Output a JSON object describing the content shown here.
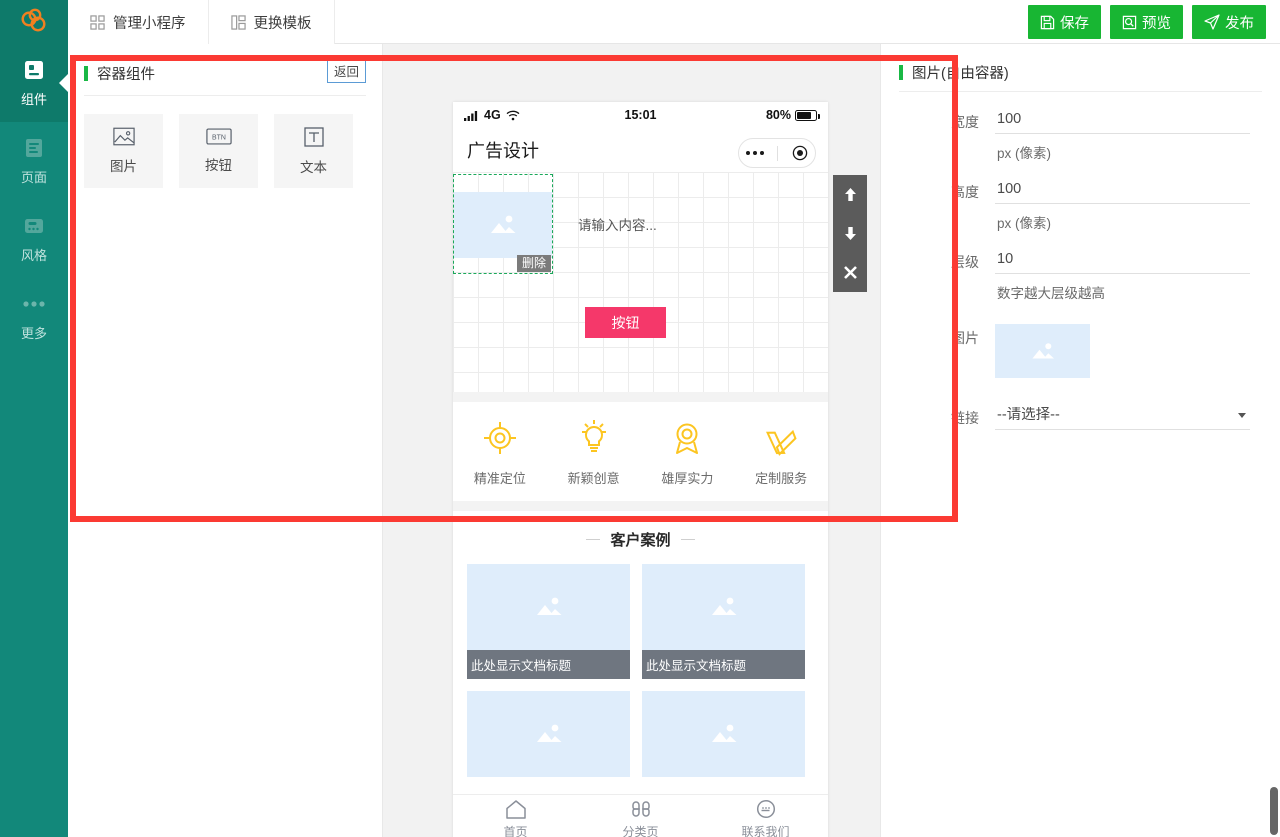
{
  "topbar": {
    "logo_icon": "cloud-logo-icon",
    "nav": [
      {
        "label": "管理小程序",
        "icon": "grid-icon"
      },
      {
        "label": "更换模板",
        "icon": "template-icon"
      }
    ],
    "actions": [
      {
        "label": "保存",
        "icon": "save-icon"
      },
      {
        "label": "预览",
        "icon": "preview-icon"
      },
      {
        "label": "发布",
        "icon": "publish-icon"
      }
    ],
    "accent": "#18b633"
  },
  "rail": {
    "items": [
      {
        "label": "组件",
        "icon": "component-icon",
        "active": true
      },
      {
        "label": "页面",
        "icon": "page-icon",
        "active": false
      },
      {
        "label": "风格",
        "icon": "style-icon",
        "active": false
      },
      {
        "label": "更多",
        "icon": "more-dots-icon",
        "active": false
      }
    ],
    "bg": "#12887a",
    "active_bg": "#0e7a6a"
  },
  "left_panel": {
    "title": "容器组件",
    "back_label": "返回",
    "components": [
      {
        "label": "图片",
        "icon": "image-icon"
      },
      {
        "label": "按钮",
        "icon": "btn-icon"
      },
      {
        "label": "文本",
        "icon": "text-icon"
      }
    ]
  },
  "phone": {
    "status": {
      "signal": "signal-icon",
      "network": "4G",
      "wifi": "wifi-icon",
      "time": "15:01",
      "battery_pct": "80%"
    },
    "nav_title": "广告设计",
    "capsule": {
      "more": "more-dots-icon",
      "target": "target-icon"
    },
    "canvas": {
      "selected_label": "删除",
      "text_placeholder": "请输入内容...",
      "button_label": "按钮",
      "button_color": "#f5386a"
    },
    "features": [
      {
        "label": "精准定位",
        "icon": "target-ring-icon"
      },
      {
        "label": "新颖创意",
        "icon": "lightbulb-icon"
      },
      {
        "label": "雄厚实力",
        "icon": "medal-icon"
      },
      {
        "label": "定制服务",
        "icon": "pencil-ruler-icon"
      }
    ],
    "section_title": "客户案例",
    "cases": [
      {
        "caption": "此处显示文档标题",
        "has_caption": true
      },
      {
        "caption": "此处显示文档标题",
        "has_caption": true
      },
      {
        "caption": "",
        "has_caption": false
      },
      {
        "caption": "",
        "has_caption": false
      }
    ],
    "tabbar": [
      {
        "label": "首页",
        "icon": "home-icon"
      },
      {
        "label": "分类页",
        "icon": "category-icon"
      },
      {
        "label": "联系我们",
        "icon": "chat-icon"
      }
    ]
  },
  "float_tools": [
    {
      "name": "move-up",
      "icon": "arrow-up-icon"
    },
    {
      "name": "move-down",
      "icon": "arrow-down-icon"
    },
    {
      "name": "close",
      "icon": "close-x-icon"
    }
  ],
  "right_panel": {
    "title": "图片(自由容器)",
    "props": {
      "width": {
        "label": "宽度",
        "value": "100",
        "unit": "px (像素)"
      },
      "height": {
        "label": "高度",
        "value": "100",
        "unit": "px (像素)"
      },
      "layer": {
        "label": "层级",
        "value": "10",
        "hint": "数字越大层级越高"
      },
      "image": {
        "label": "图片",
        "icon": "image-placeholder-icon"
      },
      "link": {
        "label": "链接",
        "selected": "--请选择--",
        "options": [
          "--请选择--"
        ]
      }
    }
  },
  "annotation": {
    "color": "#fb3a33"
  }
}
